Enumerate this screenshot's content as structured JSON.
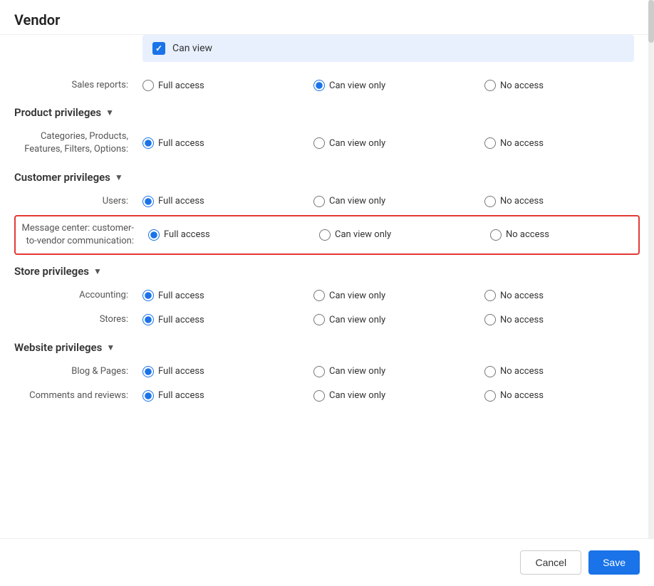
{
  "header": {
    "title": "Vendor"
  },
  "canViewRow": {
    "label": "Can view"
  },
  "sections": [
    {
      "id": "sales",
      "rows": [
        {
          "id": "sales-reports",
          "label": "Sales reports:",
          "options": [
            "Full access",
            "Can view only",
            "No access"
          ],
          "selected": "Can view only",
          "highlighted": false
        }
      ]
    },
    {
      "id": "product",
      "headerLabel": "Product privileges",
      "rows": [
        {
          "id": "categories-products",
          "label": "Categories, Products, Features, Filters, Options:",
          "options": [
            "Full access",
            "Can view only",
            "No access"
          ],
          "selected": "Full access",
          "highlighted": false
        }
      ]
    },
    {
      "id": "customer",
      "headerLabel": "Customer privileges",
      "rows": [
        {
          "id": "users",
          "label": "Users:",
          "options": [
            "Full access",
            "Can view only",
            "No access"
          ],
          "selected": "Full access",
          "highlighted": false
        },
        {
          "id": "message-center",
          "label": "Message center: customer-to-vendor communication:",
          "options": [
            "Full access",
            "Can view only",
            "No access"
          ],
          "selected": "Full access",
          "highlighted": true
        }
      ]
    },
    {
      "id": "store",
      "headerLabel": "Store privileges",
      "rows": [
        {
          "id": "accounting",
          "label": "Accounting:",
          "options": [
            "Full access",
            "Can view only",
            "No access"
          ],
          "selected": "Full access",
          "highlighted": false
        },
        {
          "id": "stores",
          "label": "Stores:",
          "options": [
            "Full access",
            "Can view only",
            "No access"
          ],
          "selected": "Full access",
          "highlighted": false
        }
      ]
    },
    {
      "id": "website",
      "headerLabel": "Website privileges",
      "rows": [
        {
          "id": "blog-pages",
          "label": "Blog & Pages:",
          "options": [
            "Full access",
            "Can view only",
            "No access"
          ],
          "selected": "Full access",
          "highlighted": false
        },
        {
          "id": "comments-reviews",
          "label": "Comments and reviews:",
          "options": [
            "Full access",
            "Can view only",
            "No access"
          ],
          "selected": "Full access",
          "highlighted": false
        }
      ]
    }
  ],
  "footer": {
    "cancel_label": "Cancel",
    "save_label": "Save"
  }
}
